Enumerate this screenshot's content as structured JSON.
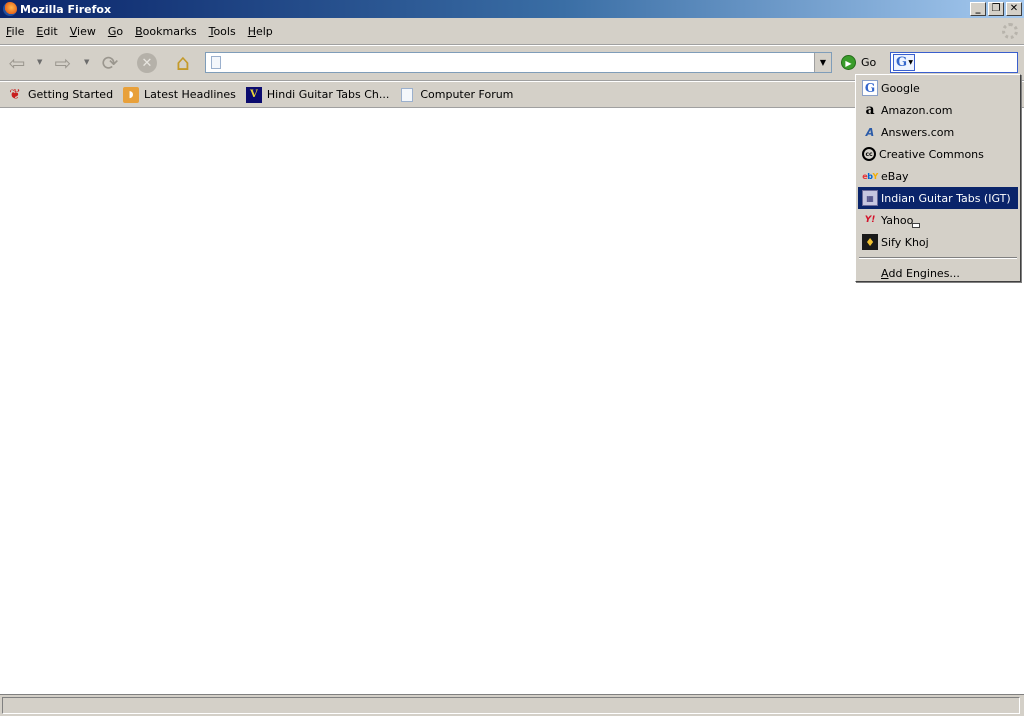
{
  "window": {
    "title": "Mozilla Firefox",
    "buttons": {
      "minimize": "_",
      "restore": "❐",
      "close": "✕"
    }
  },
  "menu": [
    {
      "key": "F",
      "rest": "ile"
    },
    {
      "key": "E",
      "rest": "dit"
    },
    {
      "key": "V",
      "rest": "iew"
    },
    {
      "key": "G",
      "rest": "o"
    },
    {
      "key": "B",
      "rest": "ookmarks"
    },
    {
      "key": "T",
      "rest": "ools"
    },
    {
      "key": "H",
      "rest": "elp"
    }
  ],
  "navigation": {
    "url_value": "",
    "go_label": "Go",
    "search_value": "",
    "selected_engine_glyph": "G"
  },
  "bookmarks": [
    {
      "label": "Getting Started",
      "icon": "firefox-icon"
    },
    {
      "label": "Latest Headlines",
      "icon": "rss-icon"
    },
    {
      "label": "Hindi Guitar Tabs Ch...",
      "icon": "hindi-tabs-icon"
    },
    {
      "label": "Computer Forum",
      "icon": "page-icon"
    }
  ],
  "search_engines": [
    {
      "label": "Google",
      "icon": "google-icon",
      "glyph": "G"
    },
    {
      "label": "Amazon.com",
      "icon": "amazon-icon",
      "glyph": "a"
    },
    {
      "label": "Answers.com",
      "icon": "answers-icon",
      "glyph": "A"
    },
    {
      "label": "Creative Commons",
      "icon": "creative-commons-icon",
      "glyph": "cc"
    },
    {
      "label": "eBay",
      "icon": "ebay-icon",
      "glyph": "ebY"
    },
    {
      "label": "Indian Guitar Tabs (IGT)",
      "icon": "igt-icon",
      "glyph": "▦",
      "selected": true
    },
    {
      "label": "Yahoo",
      "icon": "yahoo-icon",
      "glyph": "Y!"
    },
    {
      "label": "Sify Khoj",
      "icon": "sify-icon",
      "glyph": "♦"
    }
  ],
  "add_engines": {
    "key": "A",
    "rest": "dd Engines..."
  },
  "status": {
    "text": ""
  },
  "colors": {
    "selection": "#0a246a",
    "chrome": "#d4d0c8",
    "title_start": "#0a246a",
    "title_end": "#a6caf0"
  }
}
